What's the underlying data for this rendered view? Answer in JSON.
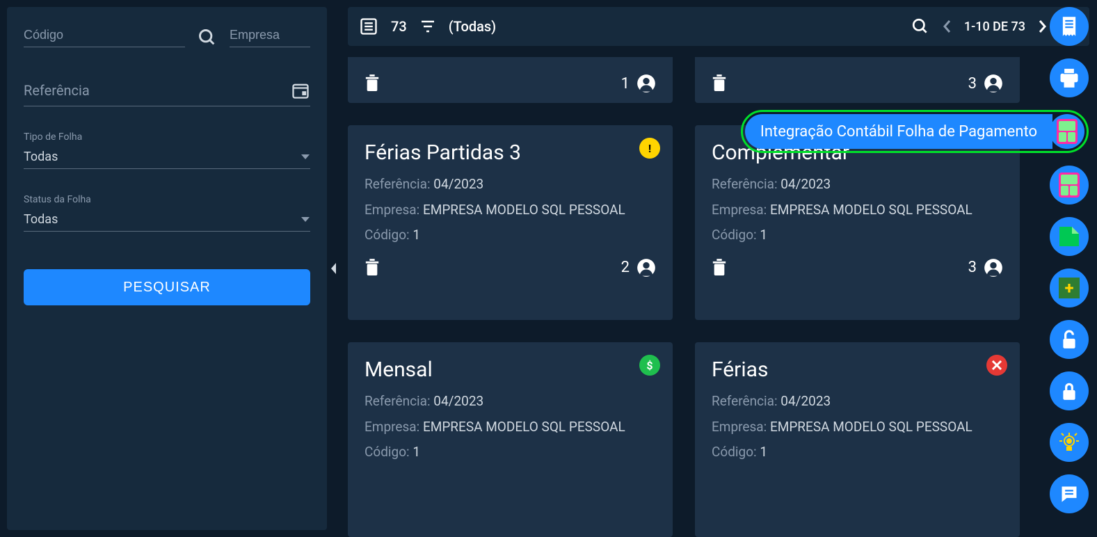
{
  "sidebar": {
    "codigo_placeholder": "Código",
    "empresa_placeholder": "Empresa",
    "referencia_placeholder": "Referência",
    "tipo_label": "Tipo de Folha",
    "tipo_value": "Todas",
    "status_label": "Status da Folha",
    "status_value": "Todas",
    "search_button": "PESQUISAR"
  },
  "toolbar": {
    "count": "73",
    "filter_text": "(Todas)",
    "pagination": "1-10 DE 73"
  },
  "tooltip": {
    "integracao": "Integração Contábil Folha de Pagamento"
  },
  "cards": [
    {
      "partial": true,
      "footer_num": "1"
    },
    {
      "partial": true,
      "footer_num": "3"
    },
    {
      "title": "Férias Partidas 3",
      "referencia_label": "Referência:",
      "referencia": "04/2023",
      "empresa_label": "Empresa:",
      "empresa": "EMPRESA MODELO SQL PESSOAL",
      "codigo_label": "Código:",
      "codigo": "1",
      "footer_num": "2",
      "status": "warning"
    },
    {
      "title": "Complementar",
      "referencia_label": "Referência:",
      "referencia": "04/2023",
      "empresa_label": "Empresa:",
      "empresa": "EMPRESA MODELO SQL PESSOAL",
      "codigo_label": "Código:",
      "codigo": "1",
      "footer_num": "3",
      "status": null
    },
    {
      "title": "Mensal",
      "referencia_label": "Referência:",
      "referencia": "04/2023",
      "empresa_label": "Empresa:",
      "empresa": "EMPRESA MODELO SQL PESSOAL",
      "codigo_label": "Código:",
      "codigo": "1",
      "footer_num": "",
      "status": "money"
    },
    {
      "title": "Férias",
      "referencia_label": "Referência:",
      "referencia": "04/2023",
      "empresa_label": "Empresa:",
      "empresa": "EMPRESA MODELO SQL PESSOAL",
      "codigo_label": "Código:",
      "codigo": "1",
      "footer_num": "",
      "status": "close"
    }
  ]
}
